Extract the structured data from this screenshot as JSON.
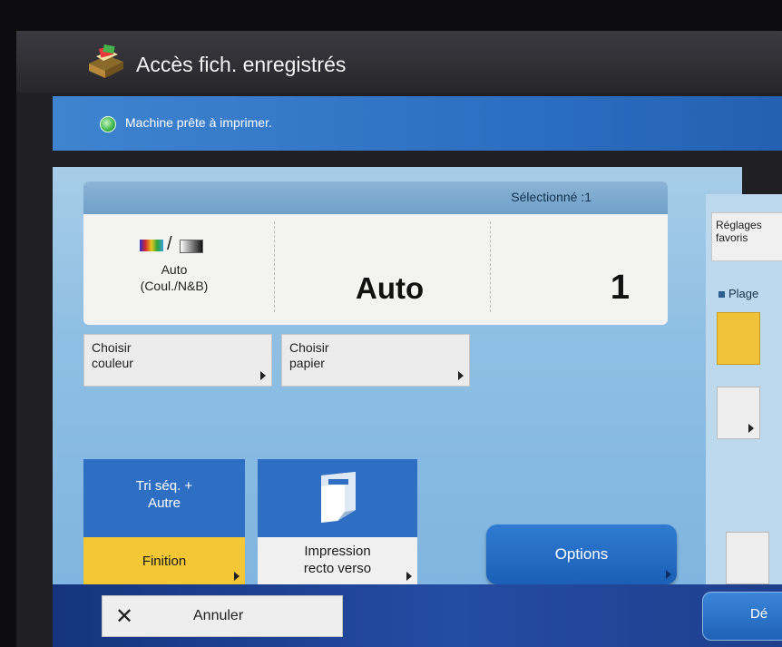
{
  "header": {
    "title": "Accès fich. enregistrés",
    "icon": "printer-box-icon"
  },
  "status": {
    "text": "Machine prête à imprimer.",
    "icon": "status-ok-icon",
    "color": "#38b54a"
  },
  "summary": {
    "selected": "Sélectionné :1",
    "color_mode": {
      "line1": "Auto",
      "line2": "(Coul./N&B)"
    },
    "paper_value": "Auto",
    "quantity": "1"
  },
  "buttons": {
    "choose_color": {
      "line1": "Choisir",
      "line2": "couleur"
    },
    "choose_paper": {
      "line1": "Choisir",
      "line2": "papier"
    },
    "finishing": {
      "sub1": "Tri séq. +",
      "sub2": "Autre",
      "label": "Finition"
    },
    "duplex": {
      "line1": "Impression",
      "line2": "recto verso"
    },
    "options": "Options"
  },
  "right_panel": {
    "favorites": {
      "line1": "Réglages",
      "line2": "favoris"
    },
    "range": "Plage"
  },
  "footer": {
    "cancel": "Annuler",
    "start": "Dé"
  },
  "colors": {
    "accent_blue": "#2f6fc3",
    "finishing_yellow": "#f3c735",
    "panel": "#8fbfe3"
  }
}
